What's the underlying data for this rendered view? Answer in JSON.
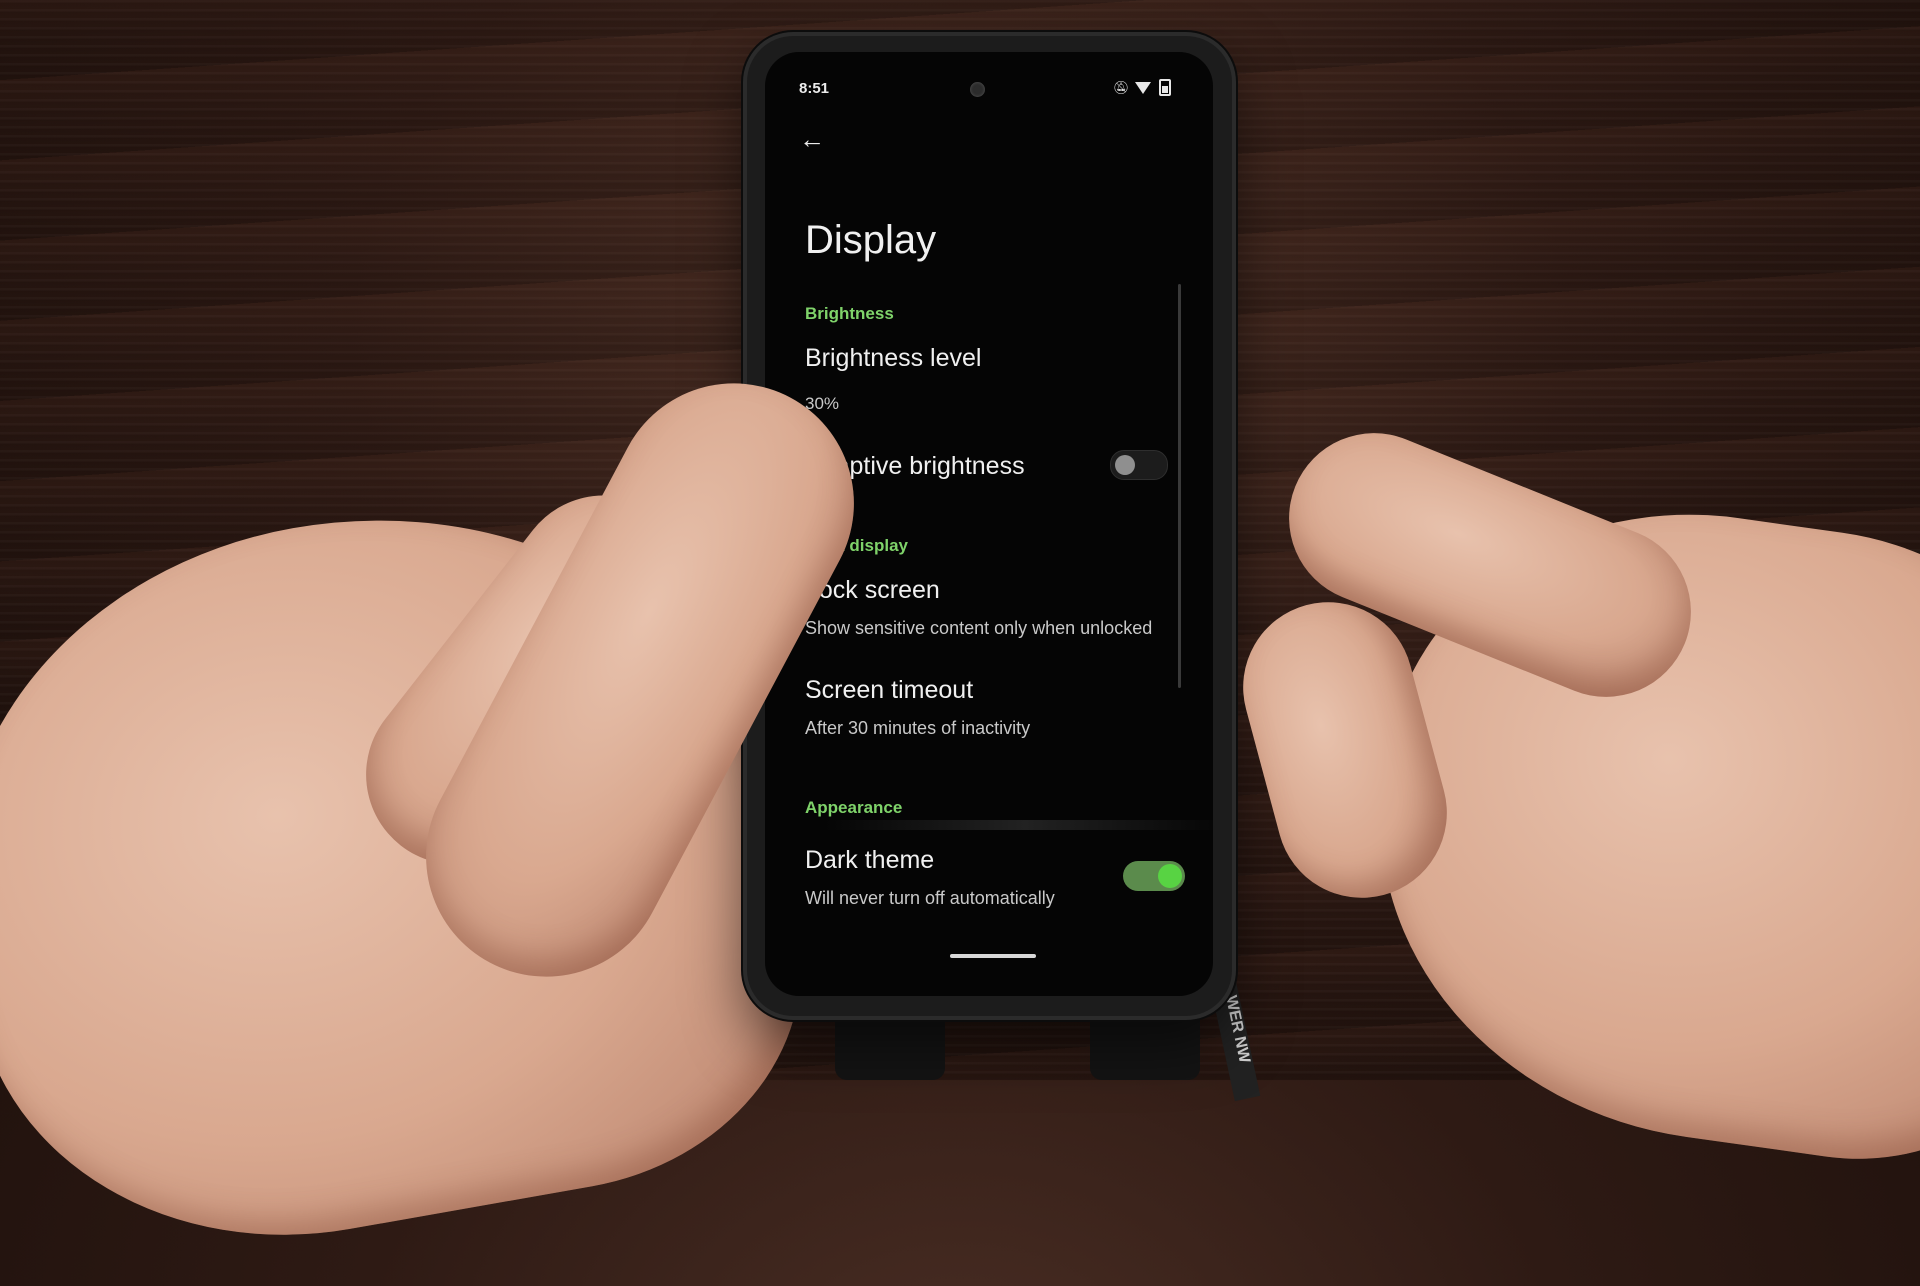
{
  "status_bar": {
    "time": "8:51",
    "icons": [
      "mute-icon",
      "wifi-icon",
      "battery-icon"
    ]
  },
  "nav": {
    "back_icon": "arrow-left-icon"
  },
  "page": {
    "title": "Display"
  },
  "sections": {
    "brightness": {
      "header": "Brightness",
      "level_title": "Brightness level",
      "level_value": "30%",
      "adaptive_title": "Adaptive brightness",
      "adaptive_enabled": false
    },
    "lock_display": {
      "header": "Lock display",
      "lock_screen_title": "Lock screen",
      "lock_screen_sub": "Show sensitive content only when unlocked",
      "timeout_title": "Screen timeout",
      "timeout_sub": "After 30 minutes of inactivity"
    },
    "appearance": {
      "header": "Appearance",
      "dark_theme_title": "Dark theme",
      "dark_theme_sub": "Will never turn off automatically",
      "dark_theme_enabled": true
    }
  },
  "cable_text": "WER NW",
  "colors": {
    "accent_green": "#7fd36a",
    "toggle_on_knob": "#58d343",
    "screen_bg": "#050505"
  }
}
